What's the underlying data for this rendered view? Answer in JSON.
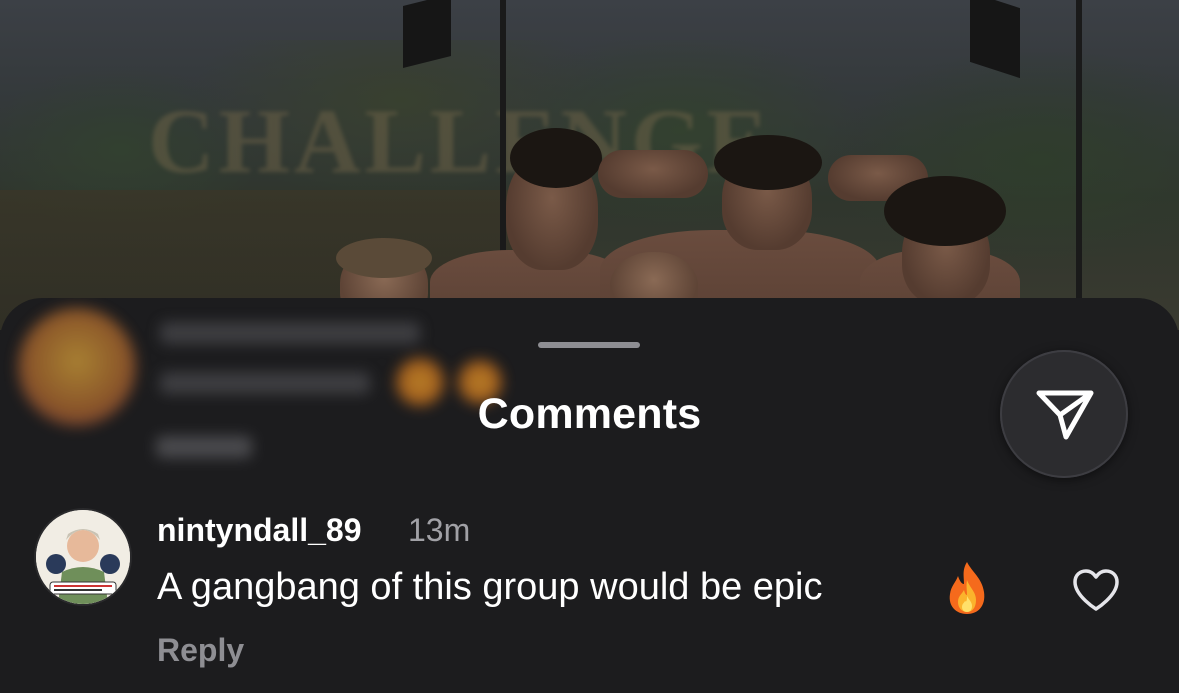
{
  "background": {
    "sign_text": "CHALLENGE"
  },
  "sheet": {
    "title": "Comments",
    "share_icon": "paper-plane-icon"
  },
  "blurred_comment": {
    "reply_label": "Reply"
  },
  "comment": {
    "username": "nintyndall_89",
    "time": "13m",
    "text": "A gangbang of this group would be epic",
    "emoji": "fire-emoji",
    "reply_label": "Reply",
    "like_icon": "heart-outline-icon"
  },
  "colors": {
    "sheet_bg": "#1c1c1e",
    "primary_text": "#ffffff",
    "secondary_text": "#a1a1a6",
    "reply_text": "#8e8e93"
  }
}
